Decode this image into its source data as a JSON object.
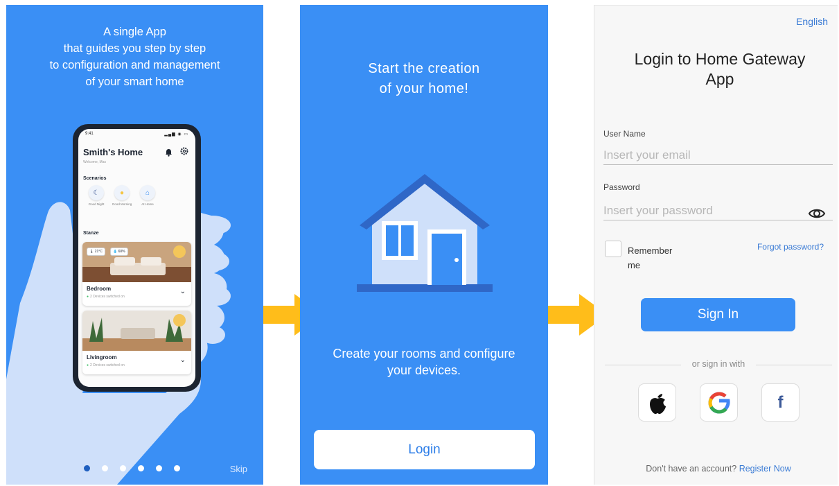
{
  "colors": {
    "primary_blue": "#3a8ff5",
    "dark_blue": "#2f67c7",
    "light_blue": "#cfe0fa",
    "arrow_yellow": "#ffbd1a",
    "link_blue": "#3a7bd5"
  },
  "onboarding": {
    "intro_lines": [
      "A single App",
      "that guides you step by step",
      "to configuration and management",
      "of your smart home"
    ],
    "skip_label": "Skip",
    "page_count": 6,
    "active_page": 1,
    "phone": {
      "status_time": "9:41",
      "status_icons": "▂▄▆ ◉ ▭",
      "home_title": "Smith's Home",
      "home_subtitle": "Welcome, Max",
      "bell_icon": "bell-icon",
      "gear_icon": "gear-icon",
      "scenarios_label": "Scenarios",
      "scenarios": [
        {
          "icon": "moon-icon",
          "glyph": "☾",
          "label": "Good Night"
        },
        {
          "icon": "sun-icon",
          "glyph": "●",
          "label": "Good Morning"
        },
        {
          "icon": "home-icon",
          "glyph": "⌂",
          "label": "At Home"
        }
      ],
      "rooms_label": "Stanze",
      "rooms": [
        {
          "name": "Bedroom",
          "devices": "2 Devices switched on",
          "temp": "🌡 21°C",
          "humidity": "💧 60%"
        },
        {
          "name": "Livingroom",
          "devices": "2 Devices switched on"
        }
      ]
    }
  },
  "create": {
    "title_lines": [
      "Start the creation",
      "of your home!"
    ],
    "subtitle_lines": [
      "Create your rooms and configure",
      "your devices."
    ],
    "login_label": "Login"
  },
  "login": {
    "language": "English",
    "title_lines": [
      "Login to Home Gateway",
      "App"
    ],
    "username_label": "User Name",
    "username_placeholder": "Insert your email",
    "password_label": "Password",
    "password_placeholder": "Insert your password",
    "remember_label": "Remember me",
    "forgot_label": "Forgot password?",
    "signin_label": "Sign In",
    "or_label": "or sign in with",
    "no_account_label": "Don't have an account?",
    "register_label": "Register Now"
  }
}
